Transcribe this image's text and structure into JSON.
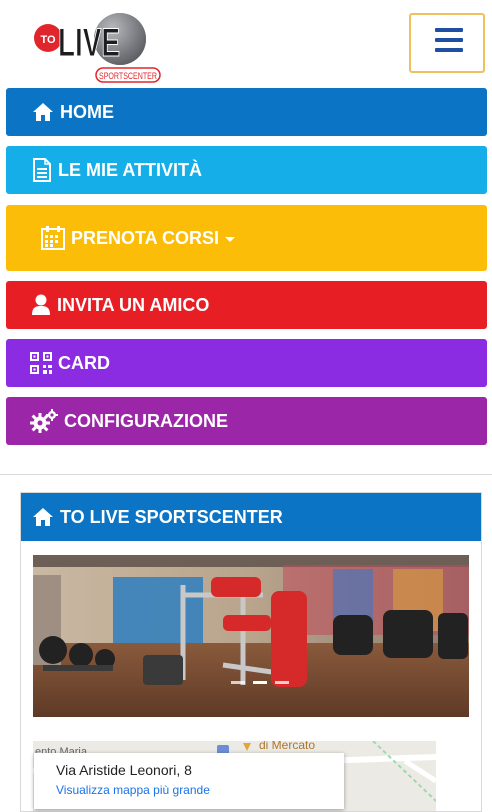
{
  "brand": {
    "logo_prefix": "TO",
    "logo_main": "LIVE",
    "logo_sub": "SPORTSCENTER"
  },
  "menu": [
    {
      "key": "home",
      "label": "HOME",
      "color": "#0b74c4",
      "icon": "home-icon"
    },
    {
      "key": "attivita",
      "label": "LE MIE ATTIVITÀ",
      "color": "#15aee8",
      "icon": "document-icon"
    },
    {
      "key": "prenota",
      "label": "PRENOTA CORSI",
      "color": "#fbbd08",
      "icon": "calendar-icon",
      "dropdown": true
    },
    {
      "key": "invita",
      "label": "INVITA UN AMICO",
      "color": "#e81e25",
      "icon": "user-icon"
    },
    {
      "key": "card",
      "label": "CARD",
      "color": "#8b2be2",
      "icon": "qr-code-icon"
    },
    {
      "key": "config",
      "label": "CONFIGURAZIONE",
      "color": "#9b27a8",
      "icon": "gears-icon"
    }
  ],
  "panel": {
    "title": "TO LIVE SPORTSCENTER",
    "color": "#0b74c4",
    "carousel": {
      "slides": 3,
      "active": 2
    }
  },
  "map": {
    "label_top": "di Mercato",
    "label_left": "ento Maria",
    "address": "Via Aristide Leonori, 8",
    "link": "Visualizza mappa più grande"
  }
}
